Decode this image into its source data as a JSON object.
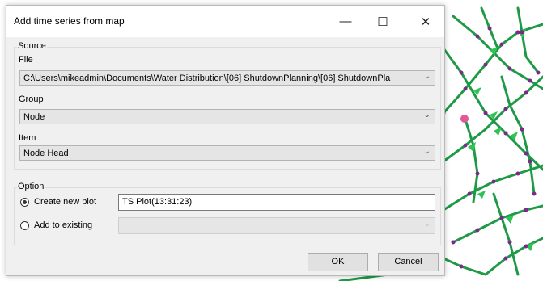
{
  "dialog": {
    "title": "Add time series from map",
    "window_controls": {
      "minimize": "—",
      "maximize": "☐",
      "close": "✕"
    },
    "source": {
      "legend": "Source",
      "file_label": "File",
      "file_value": "C:\\Users\\mikeadmin\\Documents\\Water Distribution\\[06] ShutdownPlanning\\[06] ShutdownPla",
      "group_label": "Group",
      "group_value": "Node",
      "item_label": "Item",
      "item_value": "Node Head"
    },
    "option": {
      "legend": "Option",
      "create_new_label": "Create new plot",
      "create_new_selected": true,
      "plot_name_value": "TS Plot(13:31:23)",
      "add_existing_label": "Add to existing",
      "add_existing_selected": false,
      "existing_value": ""
    },
    "buttons": {
      "ok": "OK",
      "cancel": "Cancel"
    }
  },
  "icons": {
    "chevron": "chevron-down-icon"
  },
  "colors": {
    "map_pipe": "#1e9a46",
    "map_node": "#7b2a8c",
    "map_highlight": "#e05a9a",
    "map_arrow": "#2fc257"
  }
}
